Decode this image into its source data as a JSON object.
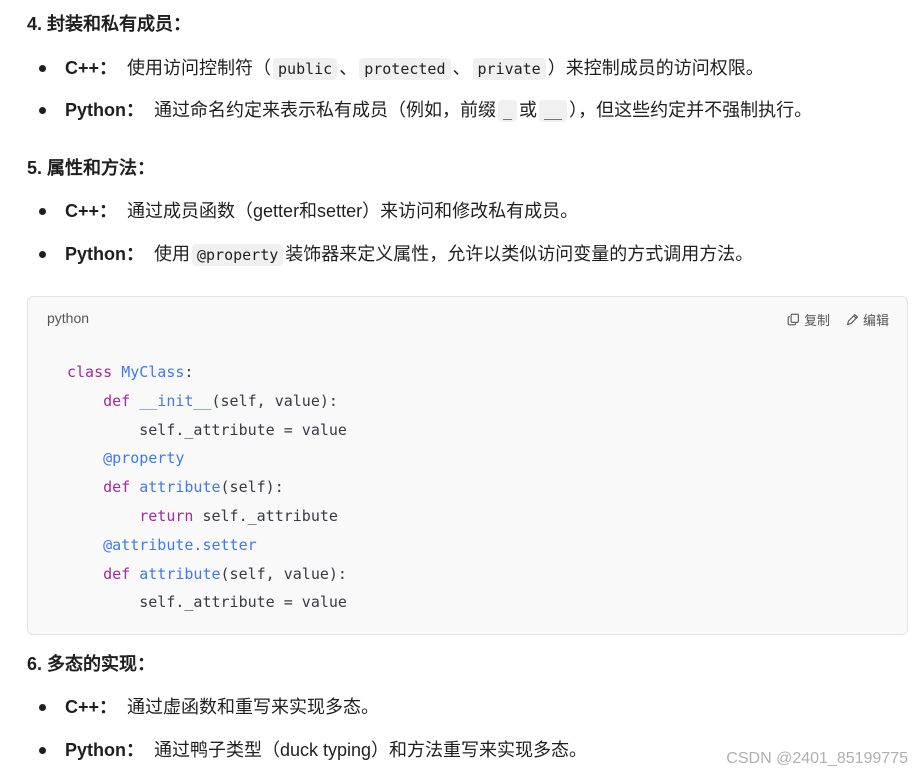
{
  "sections": {
    "s4": {
      "heading": "4. 封装和私有成员：",
      "cpp_label": "C++：",
      "cpp_pre": "使用访问控制符（",
      "cpp_kw1": "public",
      "cpp_sep1": "、",
      "cpp_kw2": "protected",
      "cpp_sep2": "、",
      "cpp_kw3": "private",
      "cpp_post": "）来控制成员的访问权限。",
      "py_label": "Python：",
      "py_pre": "通过命名约定来表示私有成员（例如，前缀",
      "py_kw1": "_",
      "py_mid": "或",
      "py_kw2": "__",
      "py_post": "），但这些约定并不强制执行。"
    },
    "s5": {
      "heading": "5. 属性和方法：",
      "cpp_label": "C++：",
      "cpp_text": "通过成员函数（getter和setter）来访问和修改私有成员。",
      "py_label": "Python：",
      "py_pre": "使用",
      "py_kw": "@property",
      "py_post": "装饰器来定义属性，允许以类似访问变量的方式调用方法。"
    },
    "code": {
      "language": "python",
      "copy_label": "复制",
      "edit_label": "编辑",
      "copy_icon": "copy-icon",
      "edit_icon": "edit-icon",
      "lines": [
        "class MyClass:",
        "    def __init__(self, value):",
        "        self._attribute = value",
        "    @property",
        "    def attribute(self):",
        "        return self._attribute",
        "    @attribute.setter",
        "    def attribute(self, value):",
        "        self._attribute = value"
      ]
    },
    "s6": {
      "heading": "6. 多态的实现：",
      "cpp_label": "C++：",
      "cpp_text": "通过虚函数和重写来实现多态。",
      "py_label": "Python：",
      "py_text": "通过鸭子类型（duck typing）和方法重写来实现多态。"
    }
  },
  "watermark": "CSDN @2401_85199775",
  "colors": {
    "keyword": "#a626a4",
    "function": "#4078f2",
    "code_bg": "#f9f9f9"
  }
}
